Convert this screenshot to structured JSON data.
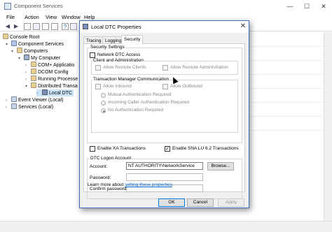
{
  "window": {
    "title": "Component Services",
    "min": "—",
    "max": "☐",
    "close": "✕"
  },
  "menu": [
    "File",
    "Action",
    "View",
    "Window",
    "Help"
  ],
  "tree": {
    "console_root": "Console Root",
    "component_services": "Component Services",
    "computers": "Computers",
    "my_computer": "My Computer",
    "com_apps": "COM+ Applicatio",
    "dcom_config": "DCOM Config",
    "running_processes": "Running Processe",
    "distributed_trans": "Distributed Transa",
    "local_dtc": "Local DTC",
    "event_viewer": "Event Viewer (Local)",
    "services": "Services (Local)"
  },
  "dialog": {
    "title": "Local DTC Properties",
    "close": "✕",
    "tabs": [
      "Tracing",
      "Logging",
      "Security"
    ],
    "active_tab": "Security",
    "security_settings": "Security Settings",
    "network_dtc_access": "Network DTC Access",
    "client_admin": "Client and Administration",
    "allow_remote_clients": "Allow Remote Clients",
    "allow_remote_admin": "Allow Remote Administration",
    "tm_comm": "Transaction Manager Communication",
    "allow_inbound": "Allow Inbound",
    "allow_outbound": "Allow Outbound",
    "mutual_auth": "Mutual Authentication Required",
    "incoming_caller_auth": "Incoming Caller Authentication Required",
    "no_auth": "No Authentication Required",
    "enable_xa": "Enable XA Transactions",
    "enable_sna": "Enable SNA LU 6.2 Transactions",
    "logon_account": "DTC Logon Account",
    "account_label": "Account:",
    "account_value": "NT AUTHORITY\\NetworkService",
    "browse": "Browse...",
    "password_label": "Password:",
    "confirm_label": "Confirm password:",
    "learn_more_prefix": "Learn more about ",
    "learn_more_link": "setting these properties",
    "learn_more_suffix": ".",
    "ok": "OK",
    "cancel": "Cancel",
    "apply": "Apply",
    "checks": {
      "network_dtc_access": false,
      "allow_remote_clients": false,
      "allow_remote_admin": false,
      "allow_inbound": false,
      "allow_outbound": false,
      "enable_xa": false,
      "enable_sna": true
    },
    "auth_selected": "No Authentication Required"
  }
}
